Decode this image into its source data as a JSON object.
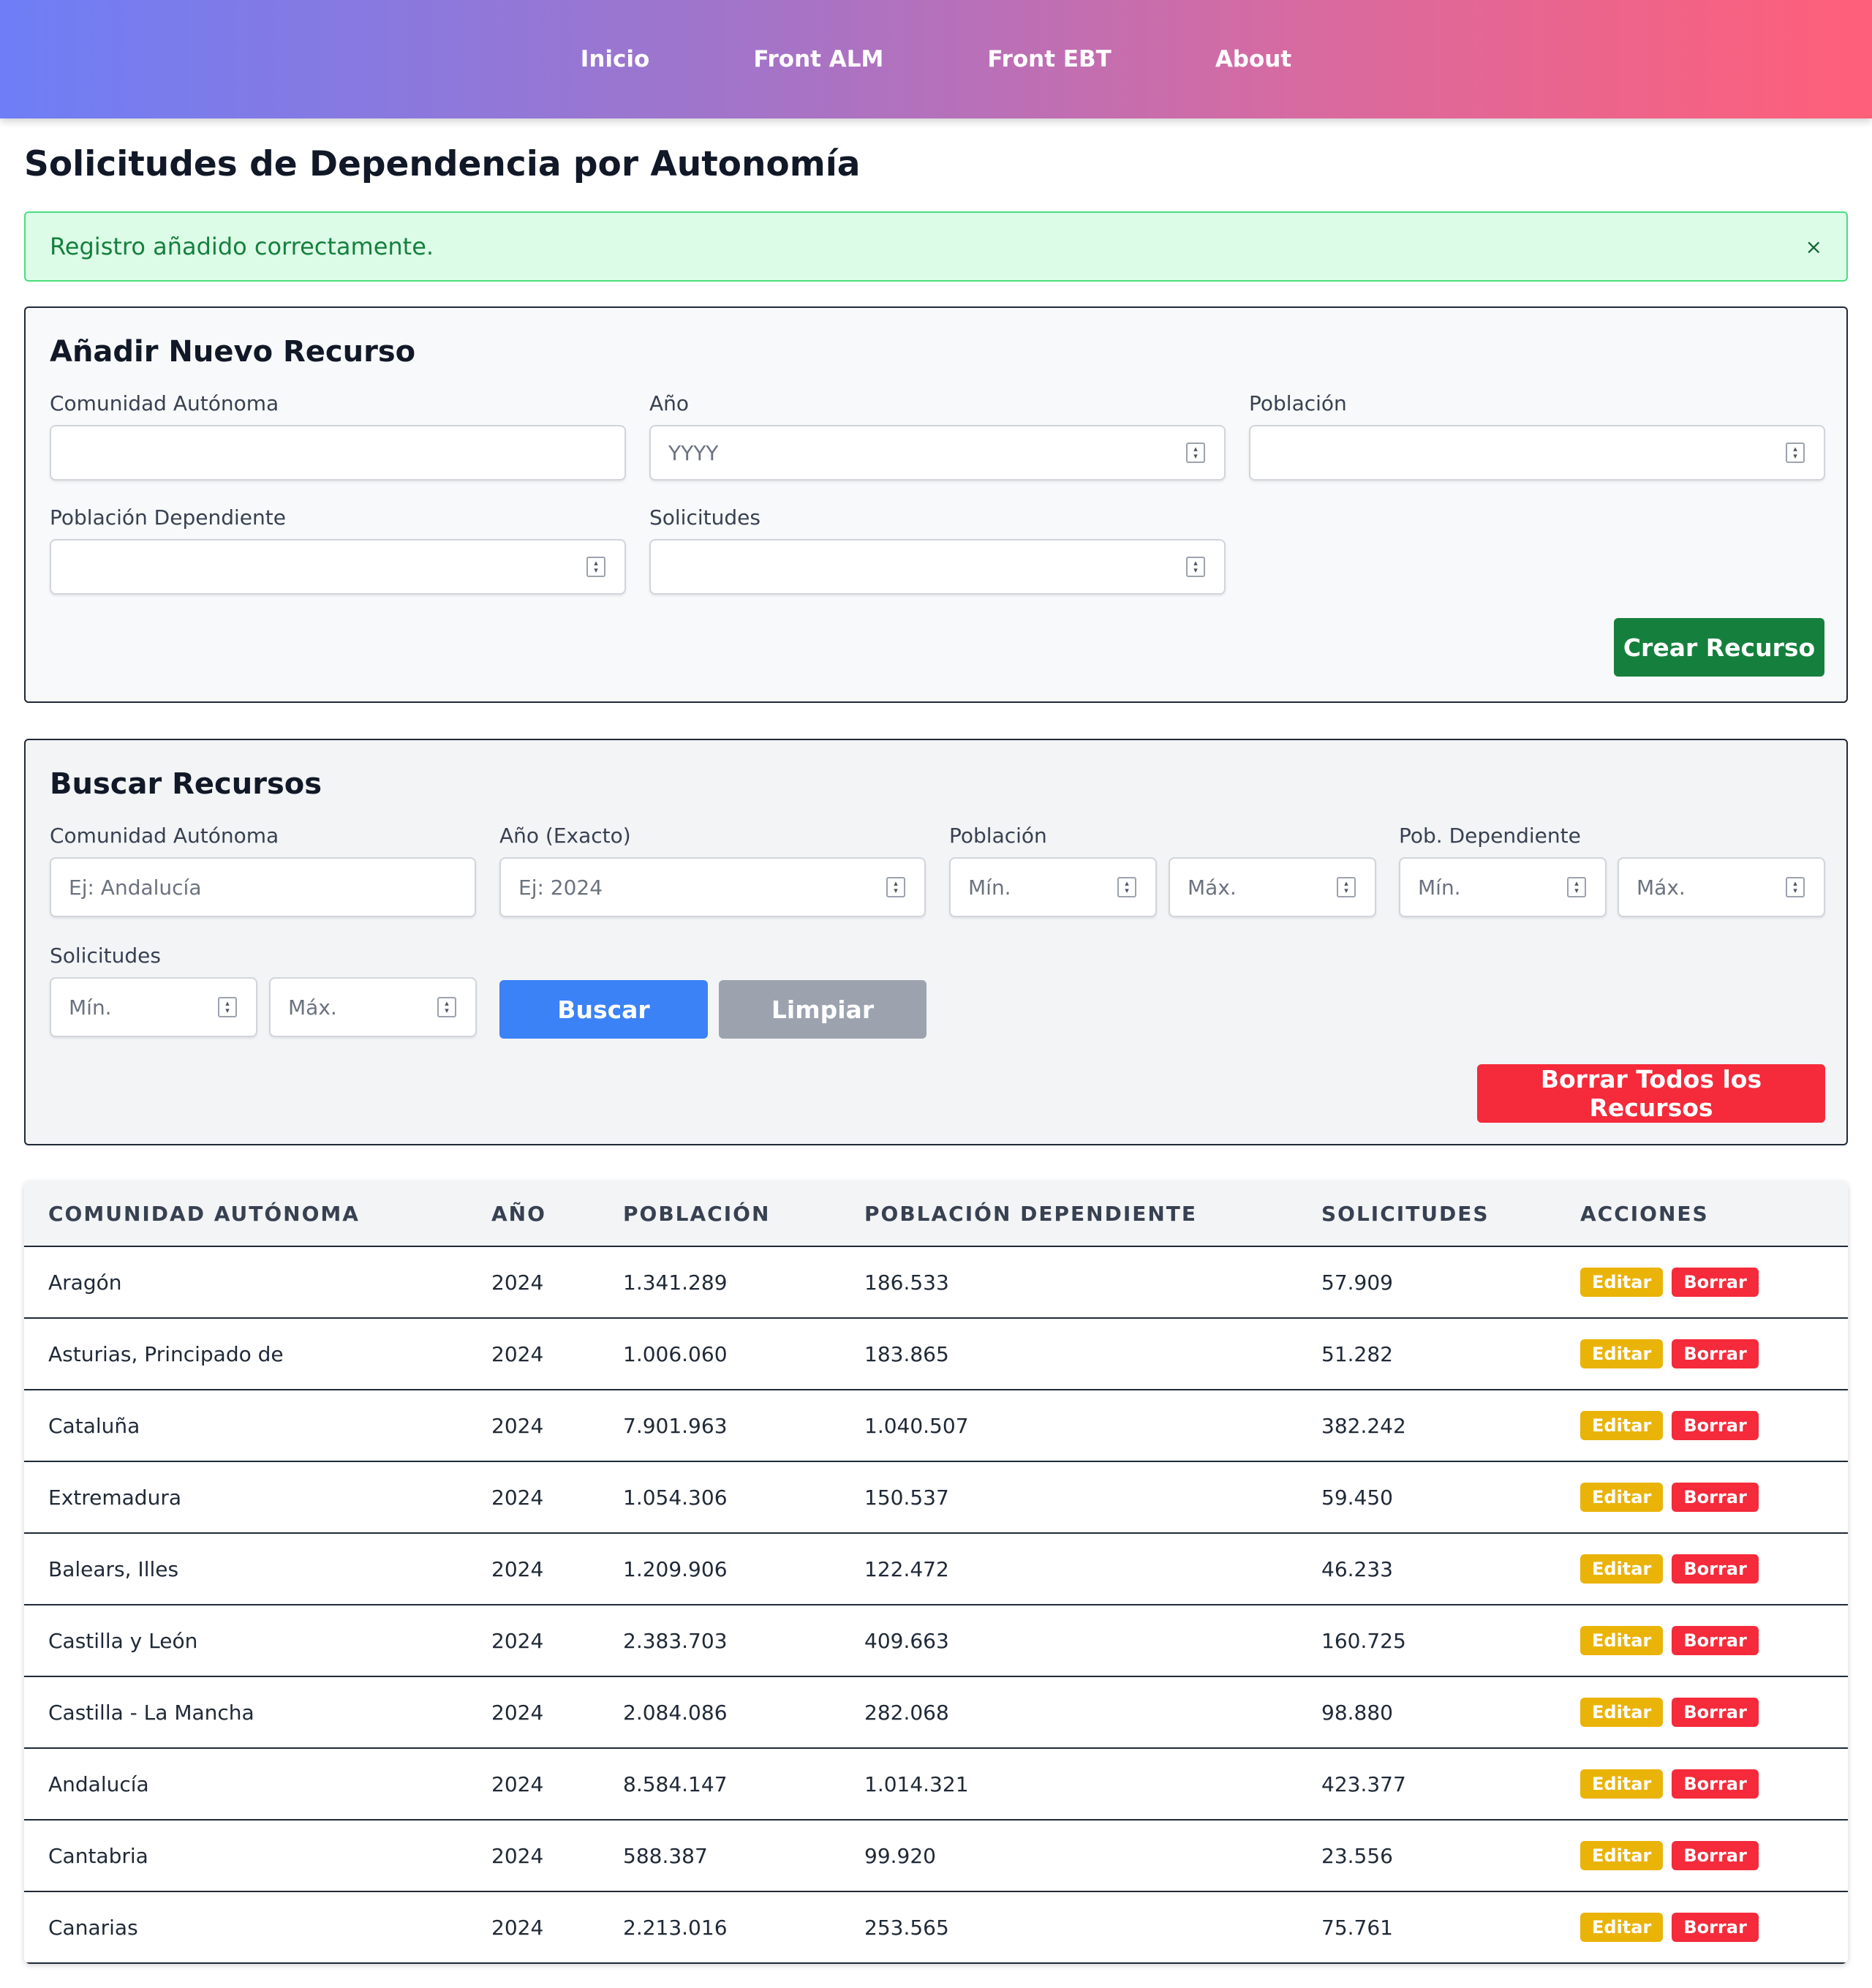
{
  "nav": {
    "items": [
      "Inicio",
      "Front ALM",
      "Front EBT",
      "About"
    ]
  },
  "page_title": "Solicitudes de Dependencia por Autonomía",
  "alert": {
    "message": "Registro añadido correctamente.",
    "close": "×"
  },
  "create": {
    "title": "Añadir Nuevo Recurso",
    "labels": {
      "comunidad": "Comunidad Autónoma",
      "anio": "Año",
      "poblacion": "Población",
      "poblacion_dep": "Población Dependiente",
      "solicitudes": "Solicitudes"
    },
    "placeholders": {
      "anio": "YYYY"
    },
    "submit": "Crear Recurso"
  },
  "search": {
    "title": "Buscar Recursos",
    "labels": {
      "comunidad": "Comunidad Autónoma",
      "anio": "Año (Exacto)",
      "poblacion": "Población",
      "pob_dep": "Pob. Dependiente",
      "solicitudes": "Solicitudes"
    },
    "placeholders": {
      "comunidad": "Ej: Andalucía",
      "anio": "Ej: 2024",
      "min": "Mín.",
      "max": "Máx."
    },
    "buscar": "Buscar",
    "limpiar": "Limpiar",
    "borrar_todos": "Borrar Todos los Recursos"
  },
  "table": {
    "headers": [
      "COMUNIDAD AUTÓNOMA",
      "AÑO",
      "POBLACIÓN",
      "POBLACIÓN DEPENDIENTE",
      "SOLICITUDES",
      "ACCIONES"
    ],
    "edit_label": "Editar",
    "delete_label": "Borrar",
    "rows": [
      [
        "Aragón",
        "2024",
        "1.341.289",
        "186.533",
        "57.909"
      ],
      [
        "Asturias, Principado de",
        "2024",
        "1.006.060",
        "183.865",
        "51.282"
      ],
      [
        "Cataluña",
        "2024",
        "7.901.963",
        "1.040.507",
        "382.242"
      ],
      [
        "Extremadura",
        "2024",
        "1.054.306",
        "150.537",
        "59.450"
      ],
      [
        "Balears, Illes",
        "2024",
        "1.209.906",
        "122.472",
        "46.233"
      ],
      [
        "Castilla y León",
        "2024",
        "2.383.703",
        "409.663",
        "160.725"
      ],
      [
        "Castilla - La Mancha",
        "2024",
        "2.084.086",
        "282.068",
        "98.880"
      ],
      [
        "Andalucía",
        "2024",
        "8.584.147",
        "1.014.321",
        "423.377"
      ],
      [
        "Cantabria",
        "2024",
        "588.387",
        "99.920",
        "23.556"
      ],
      [
        "Canarias",
        "2024",
        "2.213.016",
        "253.565",
        "75.761"
      ]
    ]
  }
}
